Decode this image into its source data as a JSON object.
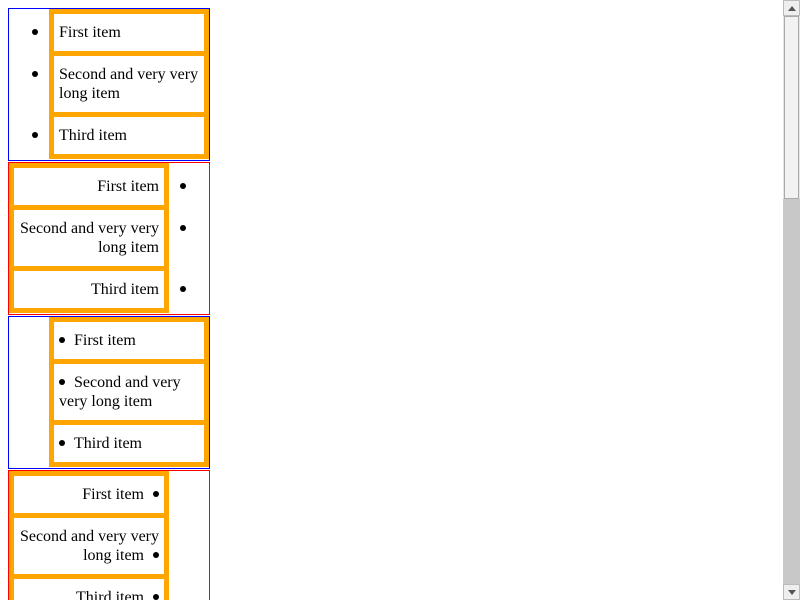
{
  "lists": [
    {
      "direction": "ltr",
      "bullet_position": "outside",
      "items": [
        "First item",
        "Second and very very long item",
        "Third item"
      ]
    },
    {
      "direction": "rtl",
      "bullet_position": "outside",
      "items": [
        "First item",
        "Second and very very long item",
        "Third item"
      ]
    },
    {
      "direction": "ltr",
      "bullet_position": "inside",
      "items": [
        "First item",
        "Second and very very long item",
        "Third item"
      ]
    },
    {
      "direction": "rtl",
      "bullet_position": "inside",
      "items": [
        "First item",
        "Second and very very long item",
        "Third item"
      ]
    }
  ],
  "colors": {
    "item_border": "#ffa500",
    "ltr_list_border": "#0000ff",
    "rtl_list_border": "#ff0000"
  }
}
